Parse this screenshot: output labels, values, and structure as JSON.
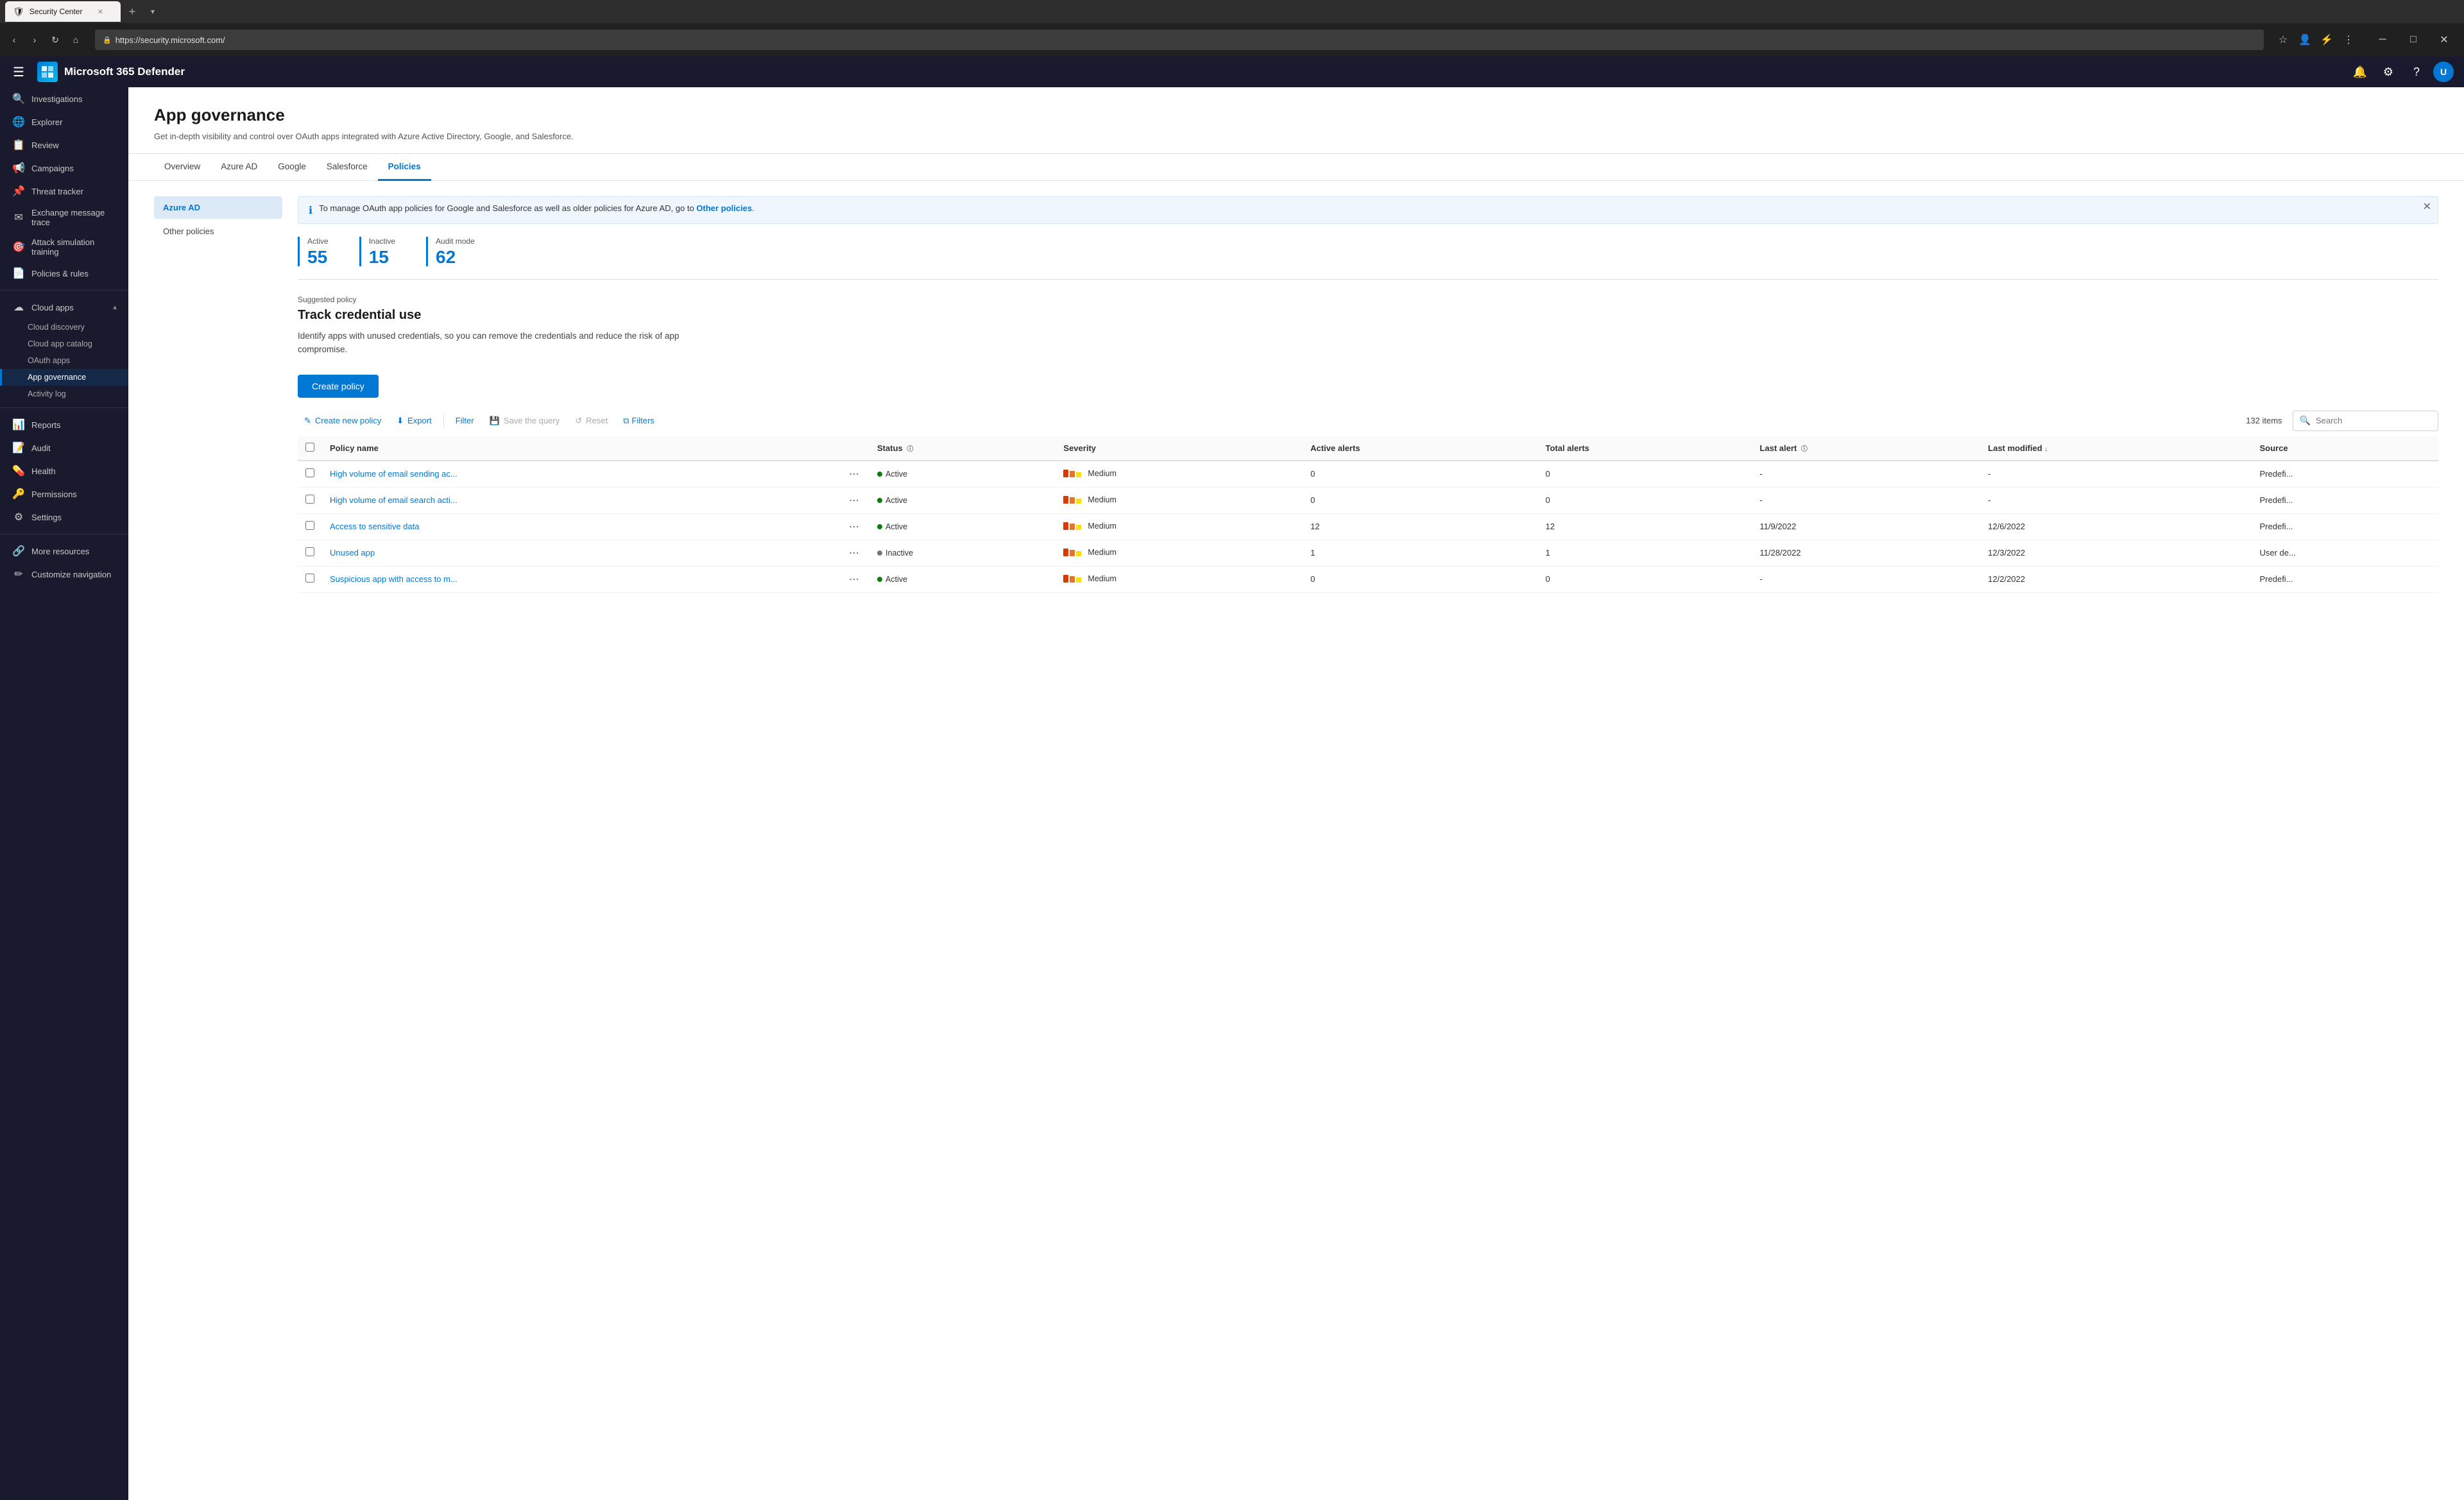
{
  "browser": {
    "tab_title": "Security Center",
    "tab_icon": "🛡",
    "url": "https://security.microsoft.com/",
    "close_btn": "✕",
    "minimize_btn": "─",
    "maximize_btn": "□"
  },
  "topnav": {
    "app_name": "Microsoft 365 Defender",
    "hamburger_icon": "☰",
    "bell_icon": "🔔",
    "settings_icon": "⚙",
    "help_icon": "?",
    "avatar_initials": "U"
  },
  "sidebar": {
    "investigations_label": "Investigations",
    "explorer_label": "Explorer",
    "review_label": "Review",
    "campaigns_label": "Campaigns",
    "threat_tracker_label": "Threat tracker",
    "exchange_msg_label": "Exchange message trace",
    "attack_sim_label": "Attack simulation training",
    "policies_rules_label": "Policies & rules",
    "cloud_apps_label": "Cloud apps",
    "cloud_discovery_label": "Cloud discovery",
    "cloud_app_catalog_label": "Cloud app catalog",
    "oauth_apps_label": "OAuth apps",
    "app_governance_label": "App governance",
    "activity_log_label": "Activity log",
    "reports_label": "Reports",
    "audit_label": "Audit",
    "health_label": "Health",
    "permissions_label": "Permissions",
    "settings_label": "Settings",
    "more_resources_label": "More resources",
    "customize_nav_label": "Customize navigation"
  },
  "page": {
    "title": "App governance",
    "subtitle": "Get in-depth visibility and control over OAuth apps integrated with Azure Active Directory, Google, and Salesforce."
  },
  "tabs": [
    {
      "label": "Overview",
      "active": false
    },
    {
      "label": "Azure AD",
      "active": false
    },
    {
      "label": "Google",
      "active": false
    },
    {
      "label": "Salesforce",
      "active": false
    },
    {
      "label": "Policies",
      "active": true
    }
  ],
  "left_panel": [
    {
      "label": "Azure AD",
      "active": true
    },
    {
      "label": "Other policies",
      "active": false
    }
  ],
  "info_banner": {
    "text": "To manage OAuth app policies for Google and Salesforce as well as older policies for Azure AD, go to ",
    "link_text": "Other policies",
    "link_suffix": "."
  },
  "stats": [
    {
      "label": "Active",
      "value": "55"
    },
    {
      "label": "Inactive",
      "value": "15"
    },
    {
      "label": "Audit mode",
      "value": "62"
    }
  ],
  "suggested_policy": {
    "section_label": "Suggested policy",
    "title": "Track credential use",
    "description": "Identify apps with unused credentials, so you can remove the credentials and reduce the risk of app compromise."
  },
  "toolbar": {
    "create_btn": "Create policy",
    "create_new_label": "Create new policy",
    "export_label": "Export",
    "filter_label": "Filter",
    "save_query_label": "Save the query",
    "reset_label": "Reset",
    "filters_label": "Filters",
    "items_count": "132 items",
    "search_placeholder": "Search"
  },
  "table": {
    "columns": [
      {
        "label": "Policy name",
        "sortable": false,
        "info": false
      },
      {
        "label": "",
        "sortable": false,
        "info": false
      },
      {
        "label": "Status",
        "sortable": false,
        "info": true
      },
      {
        "label": "Severity",
        "sortable": false,
        "info": false
      },
      {
        "label": "Active alerts",
        "sortable": false,
        "info": false
      },
      {
        "label": "Total alerts",
        "sortable": false,
        "info": false
      },
      {
        "label": "Last alert",
        "sortable": false,
        "info": true
      },
      {
        "label": "Last modified",
        "sortable": true,
        "info": false
      },
      {
        "label": "Source",
        "sortable": false,
        "info": false
      }
    ],
    "rows": [
      {
        "name": "High volume of email sending ac...",
        "status": "Active",
        "status_type": "active",
        "severity": "Medium",
        "active_alerts": "0",
        "total_alerts": "0",
        "last_alert": "-",
        "last_modified": "-",
        "source": "Predefi..."
      },
      {
        "name": "High volume of email search acti...",
        "status": "Active",
        "status_type": "active",
        "severity": "Medium",
        "active_alerts": "0",
        "total_alerts": "0",
        "last_alert": "-",
        "last_modified": "-",
        "source": "Predefi..."
      },
      {
        "name": "Access to sensitive data",
        "status": "Active",
        "status_type": "active",
        "severity": "Medium",
        "active_alerts": "12",
        "total_alerts": "12",
        "last_alert": "11/9/2022",
        "last_modified": "12/6/2022",
        "source": "Predefi..."
      },
      {
        "name": "Unused app",
        "status": "Inactive",
        "status_type": "inactive",
        "severity": "Medium",
        "active_alerts": "1",
        "total_alerts": "1",
        "last_alert": "11/28/2022",
        "last_modified": "12/3/2022",
        "source": "User de..."
      },
      {
        "name": "Suspicious app with access to m...",
        "status": "Active",
        "status_type": "active",
        "severity": "Medium",
        "active_alerts": "0",
        "total_alerts": "0",
        "last_alert": "-",
        "last_modified": "12/2/2022",
        "source": "Predefi..."
      }
    ]
  }
}
